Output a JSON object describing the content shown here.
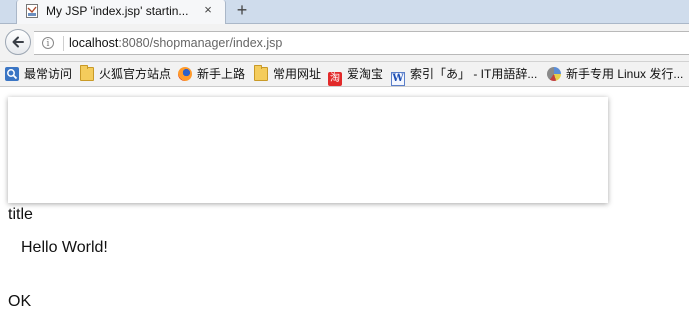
{
  "browser": {
    "tab": {
      "title": "My JSP 'index.jsp' startin...",
      "close_glyph": "×",
      "favicon": "page-favicon-icon"
    },
    "new_tab_glyph": "+",
    "url": {
      "host": "localhost",
      "rest": ":8080/shopmanager/index.jsp"
    },
    "site_info_glyph": "i",
    "bookmarks": [
      {
        "label": "最常访问",
        "icon": "search-icon"
      },
      {
        "label": "火狐官方站点",
        "icon": "folder-icon"
      },
      {
        "label": "新手上路",
        "icon": "firefox-icon"
      },
      {
        "label": "常用网址",
        "icon": "folder-icon"
      },
      {
        "label": "爱淘宝",
        "icon": "taobao-icon",
        "glyph": "淘"
      },
      {
        "label": "索引「あ」 - IT用語辞...",
        "icon": "w-icon",
        "glyph": "W"
      },
      {
        "label": "新手专用 Linux 发行...",
        "icon": "pie-chart-icon"
      }
    ]
  },
  "page": {
    "title_text": "title",
    "hello_text": "Hello World!",
    "ok_text": "OK"
  }
}
